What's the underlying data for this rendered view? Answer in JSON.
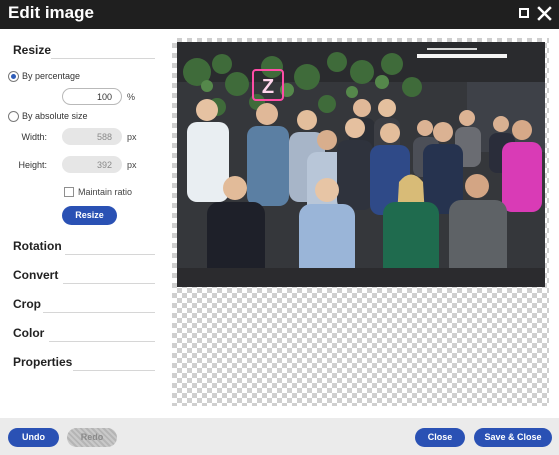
{
  "window": {
    "title": "Edit image"
  },
  "resize": {
    "heading": "Resize",
    "by_percentage_label": "By percentage",
    "percentage_value": "100",
    "percentage_unit": "%",
    "by_absolute_label": "By absolute size",
    "width_label": "Width:",
    "width_value": "588",
    "height_label": "Height:",
    "height_value": "392",
    "px_unit": "px",
    "maintain_ratio_label": "Maintain ratio",
    "resize_button": "Resize"
  },
  "sections": {
    "rotation": "Rotation",
    "convert": "Convert",
    "crop": "Crop",
    "color": "Color",
    "properties": "Properties"
  },
  "footer": {
    "undo": "Undo",
    "redo": "Redo",
    "close": "Close",
    "save_close": "Save & Close"
  },
  "photo": {
    "logo_letter": "Z",
    "logo_color": "#ff4da6"
  },
  "colors": {
    "accent": "#2a51b4",
    "titlebar": "#1f1f1f",
    "footer_bg": "#ebebeb"
  }
}
